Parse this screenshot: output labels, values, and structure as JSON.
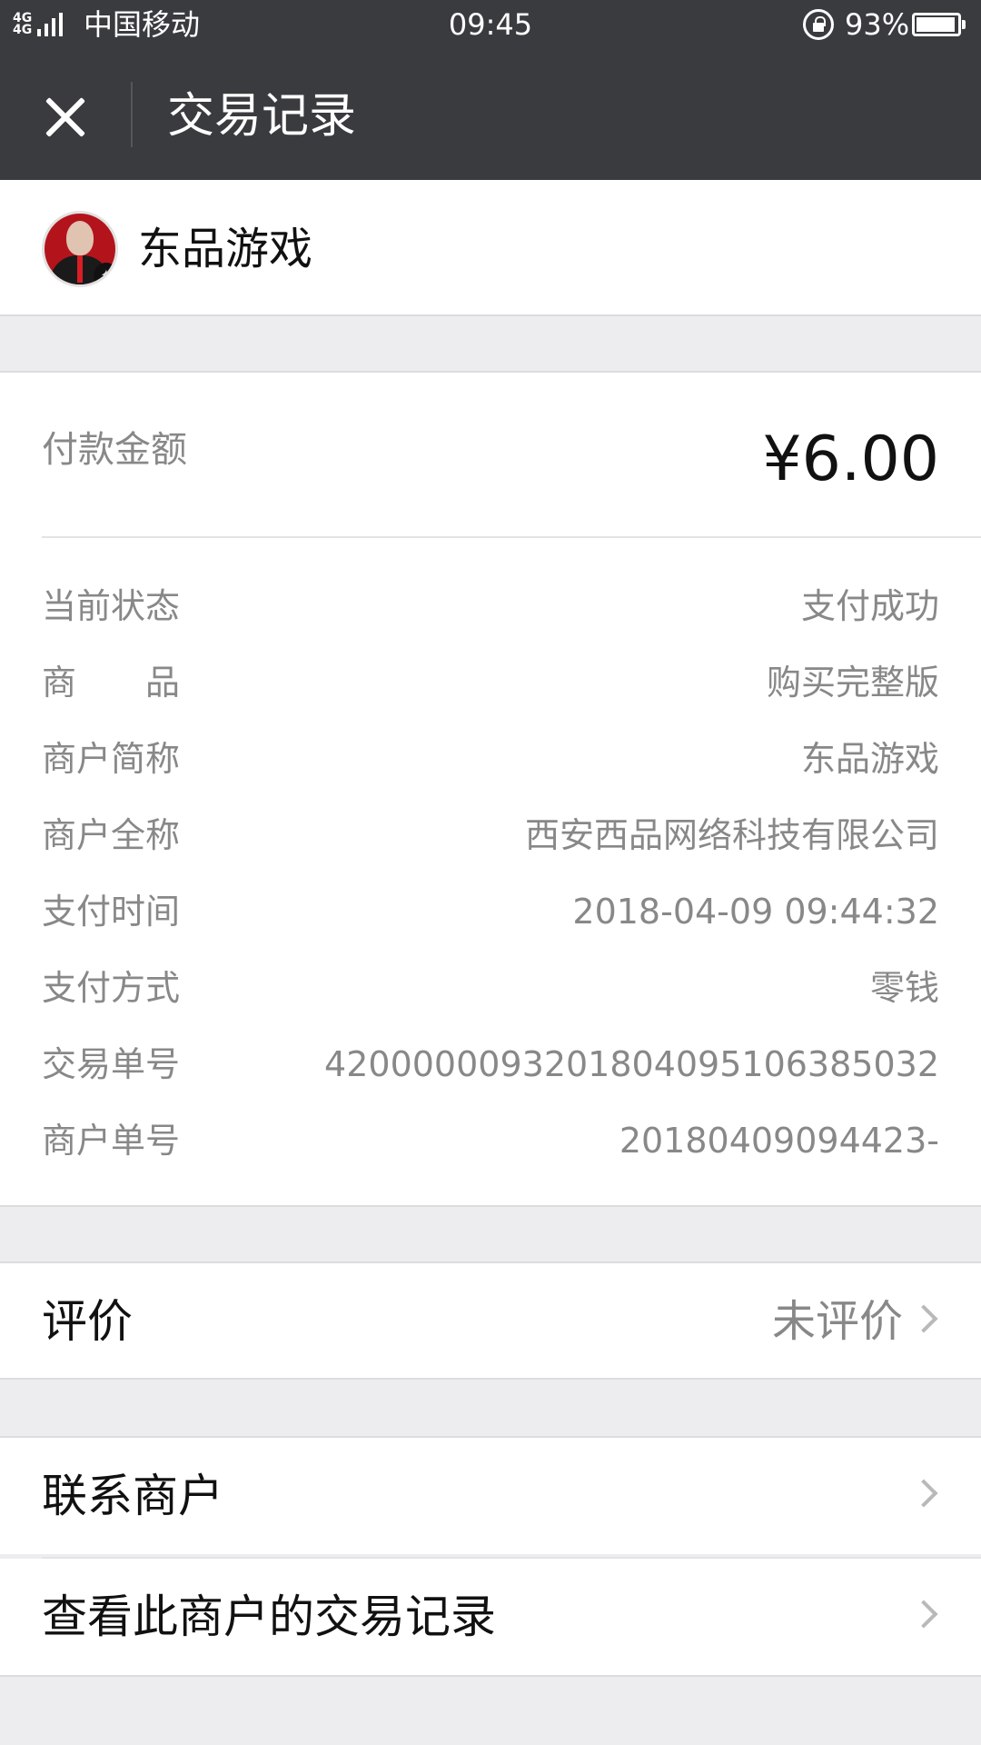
{
  "status_bar": {
    "network": "4G",
    "carrier": "中国移动",
    "time": "09:45",
    "battery": "93%"
  },
  "header": {
    "title": "交易记录"
  },
  "merchant": {
    "name": "东品游戏"
  },
  "payment": {
    "amount_label": "付款金额",
    "amount_value": "¥6.00",
    "rows": [
      {
        "key": "当前状态",
        "value": "支付成功"
      },
      {
        "key": "商　　品",
        "value": "购买完整版"
      },
      {
        "key": "商户简称",
        "value": "东品游戏"
      },
      {
        "key": "商户全称",
        "value": "西安西品网络科技有限公司"
      },
      {
        "key": "支付时间",
        "value": "2018-04-09 09:44:32"
      },
      {
        "key": "支付方式",
        "value": "零钱"
      },
      {
        "key": "交易单号",
        "value": "4200000093201804095106385032"
      },
      {
        "key": "商户单号",
        "value": "20180409094423-"
      }
    ]
  },
  "actions": {
    "review_label": "评价",
    "review_status": "未评价",
    "contact_label": "联系商户",
    "history_label": "查看此商户的交易记录"
  },
  "colors": {
    "bar_bg": "#3a3b3f",
    "page_bg": "#ededf0",
    "muted_text": "#888888"
  }
}
